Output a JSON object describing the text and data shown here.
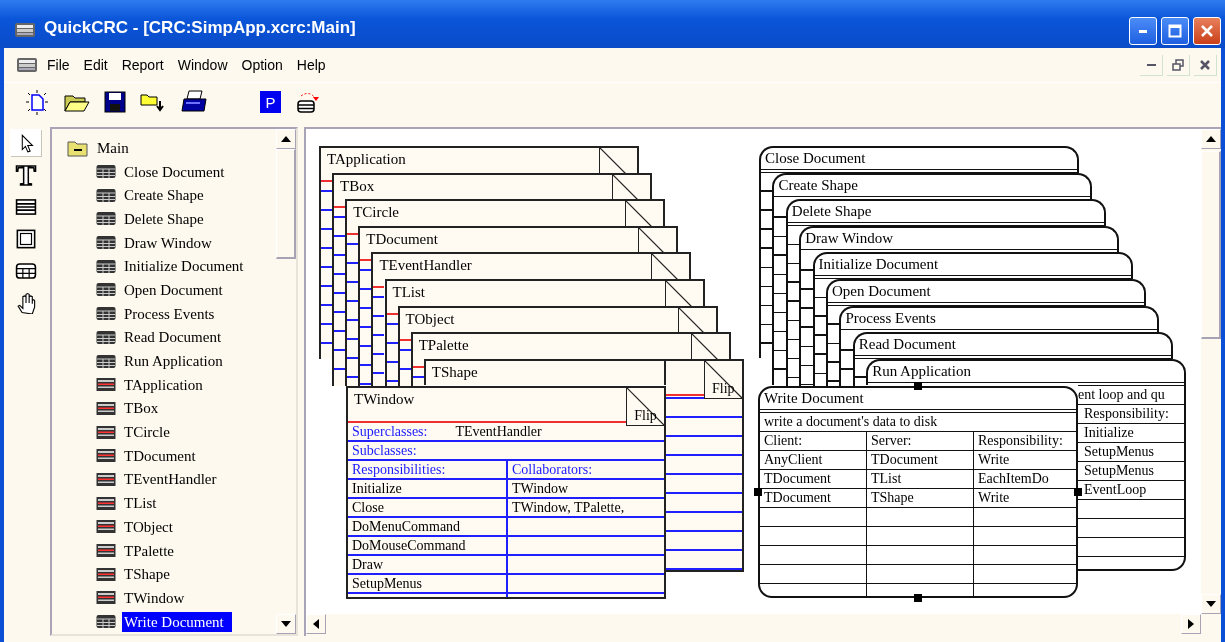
{
  "window": {
    "title": "QuickCRC - [CRC:SimpApp.xcrc:Main]"
  },
  "menu": [
    "File",
    "Edit",
    "Report",
    "Window",
    "Option",
    "Help"
  ],
  "toolbar": [
    {
      "kind": "new"
    },
    {
      "kind": "open"
    },
    {
      "kind": "save"
    },
    {
      "kind": "import"
    },
    {
      "kind": "print"
    },
    {
      "kind": "gap"
    },
    {
      "kind": "letter",
      "label": "P"
    },
    {
      "kind": "stack"
    }
  ],
  "palette": [
    {
      "kind": "pointer",
      "selected": true
    },
    {
      "kind": "letter",
      "label": "T",
      "selected": false
    },
    {
      "kind": "lines",
      "selected": false
    },
    {
      "kind": "frame",
      "selected": false
    },
    {
      "kind": "grid",
      "selected": false
    },
    {
      "kind": "hand",
      "selected": false
    }
  ],
  "tree": {
    "label": "Main",
    "expanded": true,
    "children": [
      {
        "label": "Close Document",
        "kind": "scenario",
        "selected": false
      },
      {
        "label": "Create Shape",
        "kind": "scenario",
        "selected": false
      },
      {
        "label": "Delete Shape",
        "kind": "scenario",
        "selected": false
      },
      {
        "label": "Draw Window",
        "kind": "scenario",
        "selected": false
      },
      {
        "label": "Initialize Document",
        "kind": "scenario",
        "selected": false
      },
      {
        "label": "Open Document",
        "kind": "scenario",
        "selected": false
      },
      {
        "label": "Process Events",
        "kind": "scenario",
        "selected": false
      },
      {
        "label": "Read Document",
        "kind": "scenario",
        "selected": false
      },
      {
        "label": "Run Application",
        "kind": "scenario",
        "selected": false
      },
      {
        "label": "TApplication",
        "kind": "class",
        "selected": false
      },
      {
        "label": "TBox",
        "kind": "class",
        "selected": false
      },
      {
        "label": "TCircle",
        "kind": "class",
        "selected": false
      },
      {
        "label": "TDocument",
        "kind": "class",
        "selected": false
      },
      {
        "label": "TEventHandler",
        "kind": "class",
        "selected": false
      },
      {
        "label": "TList",
        "kind": "class",
        "selected": false
      },
      {
        "label": "TObject",
        "kind": "class",
        "selected": false
      },
      {
        "label": "TPalette",
        "kind": "class",
        "selected": false
      },
      {
        "label": "TShape",
        "kind": "class",
        "selected": false
      },
      {
        "label": "TWindow",
        "kind": "class",
        "selected": false
      },
      {
        "label": "Write Document",
        "kind": "scenario",
        "selected": true
      }
    ]
  },
  "class_cards": [
    {
      "title": "TApplication"
    },
    {
      "title": "TBox"
    },
    {
      "title": "TCircle"
    },
    {
      "title": "TDocument"
    },
    {
      "title": "TEventHandler"
    },
    {
      "title": "TList"
    },
    {
      "title": "TObject"
    },
    {
      "title": "TPalette"
    },
    {
      "title": "TShape",
      "flip_label": "Flip"
    },
    {
      "title": "TWindow",
      "flip_label": "Flip",
      "labels": {
        "superclasses": "Superclasses:",
        "subclasses": "Subclasses:",
        "responsibilities": "Responsibilities:",
        "collaborators": "Collaborators:"
      },
      "superclasses": "TEventHandler",
      "rows": [
        {
          "responsibility": "Initialize",
          "collaborator": "TWindow"
        },
        {
          "responsibility": "Close",
          "collaborator": "TWindow, TPalette,"
        },
        {
          "responsibility": "DoMenuCommand"
        },
        {
          "responsibility": "DoMouseCommand"
        },
        {
          "responsibility": "Draw"
        },
        {
          "responsibility": "SetupMenus"
        }
      ]
    }
  ],
  "scenario_cards": [
    {
      "title": "Close Document",
      "selected": false
    },
    {
      "title": "Create Shape",
      "selected": false
    },
    {
      "title": "Delete Shape",
      "selected": false
    },
    {
      "title": "Draw Window",
      "selected": false
    },
    {
      "title": "Initialize Document",
      "selected": false
    },
    {
      "title": "Open Document",
      "selected": false
    },
    {
      "title": "Process Events",
      "selected": false
    },
    {
      "title": "Read Document",
      "selected": false
    },
    {
      "title": "Run Application",
      "selected": false,
      "description": "ent loop and qu",
      "labels": {
        "responsibility": "Responsibility:"
      },
      "rows": [
        {
          "responsibility": "Initialize"
        },
        {
          "responsibility": "SetupMenus"
        },
        {
          "responsibility": "SetupMenus"
        },
        {
          "responsibility": "EventLoop"
        }
      ]
    },
    {
      "title": "Write Document",
      "selected": true,
      "description": "write a document's data to disk",
      "labels": {
        "client": "Client:",
        "server": "Server:",
        "responsibility": "Responsibility:"
      },
      "rows": [
        {
          "client": "AnyClient",
          "server": "TDocument",
          "responsibility": "Write"
        },
        {
          "client": "TDocument",
          "server": "TList",
          "responsibility": "EachItemDo"
        },
        {
          "client": "TDocument",
          "server": "TShape",
          "responsibility": "Write"
        }
      ]
    }
  ]
}
